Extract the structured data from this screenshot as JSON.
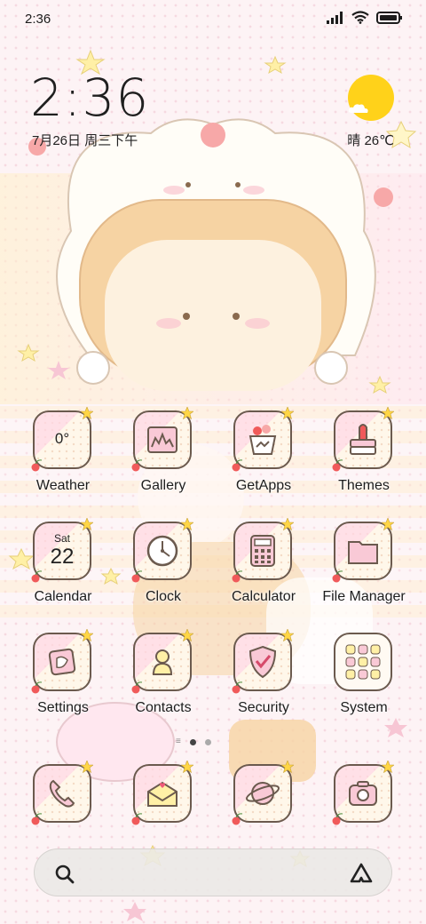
{
  "status_bar": {
    "time": "2:36",
    "icons": [
      "signal-icon",
      "wifi-icon",
      "battery-icon"
    ]
  },
  "lockscreen_widget": {
    "clock": "2:36",
    "date": "7月26日 周三下午",
    "weather": "晴 26℃",
    "weather_icon": "sunny-icon"
  },
  "apps": [
    {
      "label": "Weather",
      "icon": "weather-icon",
      "icon_text": "0°"
    },
    {
      "label": "Gallery",
      "icon": "gallery-icon"
    },
    {
      "label": "GetApps",
      "icon": "getapps-icon"
    },
    {
      "label": "Themes",
      "icon": "themes-icon"
    },
    {
      "label": "Calendar",
      "icon": "calendar-icon",
      "day": "Sat",
      "date": "22"
    },
    {
      "label": "Clock",
      "icon": "clock-icon"
    },
    {
      "label": "Calculator",
      "icon": "calculator-icon"
    },
    {
      "label": "File Manager",
      "icon": "folder-icon"
    },
    {
      "label": "Settings",
      "icon": "settings-icon"
    },
    {
      "label": "Contacts",
      "icon": "contacts-icon"
    },
    {
      "label": "Security",
      "icon": "security-icon"
    },
    {
      "label": "System",
      "icon": "system-folder-icon"
    }
  ],
  "pager": {
    "pages": 2,
    "current": 1
  },
  "dock": [
    {
      "icon": "phone-icon"
    },
    {
      "icon": "messages-icon"
    },
    {
      "icon": "browser-icon"
    },
    {
      "icon": "camera-icon"
    }
  ],
  "search_bar": {
    "left_icon": "search-icon",
    "right_icon": "assistant-icon"
  },
  "colors": {
    "accent_yellow": "#ffd21a",
    "pink": "#f7c6d4",
    "cream": "#fff7ea",
    "outline": "#6b5a4e"
  }
}
